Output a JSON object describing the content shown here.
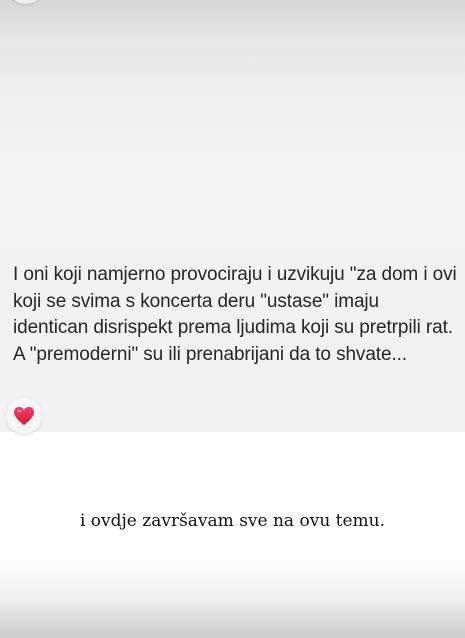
{
  "reply": {
    "text": "I oni koji namjerno provociraju i uzvikuju \"za dom i ovi koji se svima s koncerta deru \"ustase\" imaju identican disrispekt prema ljudima koji su pretrpili rat. A \"premoderni\" su ili prenabrijani da to shvate...",
    "reaction_icon": "heart-emoji-icon",
    "reaction_color": "#e0245e"
  },
  "caption": {
    "text": "i ovdje završavam sve na ovu temu."
  }
}
